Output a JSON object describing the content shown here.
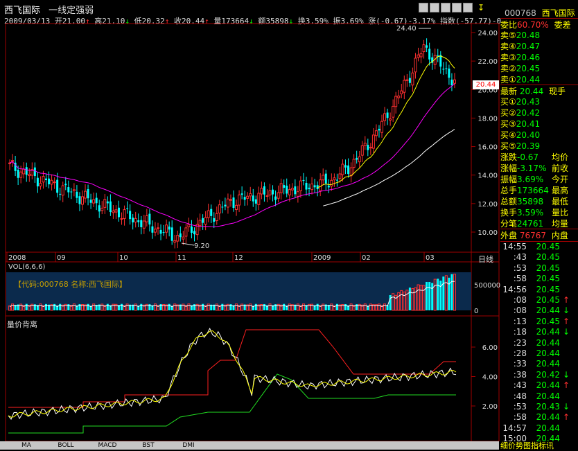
{
  "header": {
    "stock_name": "西飞国际",
    "subtitle": "一线定强弱",
    "date": "2009/03/13",
    "open_label": "开",
    "open_value": "21.00",
    "high_label": "高",
    "high_value": "21.10",
    "low_label": "低",
    "low_value": "20.32",
    "close_label": "收",
    "close_value": "20.44",
    "volume_label": "量",
    "volume_value": "173664",
    "amount_label": "额",
    "amount_value": "35898",
    "turnover_label": "换",
    "turnover_value": "3.59%",
    "amplitude_label": "振",
    "amplitude_value": "3.69%",
    "change_label": "涨",
    "change_value": "(-0.67)-3.17%",
    "index_label": "指数",
    "index_value": "(-57.77)-0"
  },
  "price_chart": {
    "yticks": [
      "24.00",
      "22.00",
      "20.00",
      "18.00",
      "16.00",
      "14.00",
      "12.00",
      "10.00"
    ],
    "current_price_tag": "20.44",
    "max_label": "24.40",
    "min_label": "9.20",
    "xaxis_labels": [
      "2008",
      "09",
      "10",
      "11",
      "12",
      "2009",
      "02",
      "03"
    ],
    "period_label": "日线",
    "colors": {
      "up": "#ff3030",
      "down": "#00ffff",
      "ma_short": "#ffffff",
      "ma_mid": "#ffff00",
      "ma_long": "#ff00ff"
    }
  },
  "volume_chart": {
    "title": "VOL(6,6,6)",
    "info_text": "【代码:000768  名称:西飞国际】",
    "ytick": "500000",
    "zero": "0"
  },
  "indicator_chart": {
    "title": "量价背离",
    "yticks": [
      "6.00",
      "4.00",
      "2.00"
    ]
  },
  "bottom_tabs": [
    "MA",
    "BOLL",
    "MACD",
    "BST",
    "DMI"
  ],
  "side_panel": {
    "code": "000768",
    "name": "西飞国际",
    "ratio_label": "委比",
    "ratio_value": "60.70%",
    "diff_label": "委差",
    "sell": [
      {
        "label": "卖⑤",
        "price": "20.48"
      },
      {
        "label": "卖④",
        "price": "20.47"
      },
      {
        "label": "卖③",
        "price": "20.46"
      },
      {
        "label": "卖②",
        "price": "20.45"
      },
      {
        "label": "卖①",
        "price": "20.44"
      }
    ],
    "latest_label": "最新",
    "latest_value": "20.44",
    "current_hand_label": "现手",
    "buy": [
      {
        "label": "买①",
        "price": "20.43"
      },
      {
        "label": "买②",
        "price": "20.42"
      },
      {
        "label": "买③",
        "price": "20.41"
      },
      {
        "label": "买④",
        "price": "20.40"
      },
      {
        "label": "买⑤",
        "price": "20.39"
      }
    ],
    "stats": [
      {
        "label": "涨跌",
        "value": "-0.67",
        "right": "均价"
      },
      {
        "label": "涨幅",
        "value": "-3.17%",
        "right": "前收"
      },
      {
        "label": "振幅",
        "value": "3.69%",
        "right": "今开"
      },
      {
        "label": "总手",
        "value": "173664",
        "right": "最高"
      },
      {
        "label": "总额",
        "value": "35898",
        "right": "最低"
      },
      {
        "label": "换手",
        "value": "3.59%",
        "right": "量比"
      },
      {
        "label": "分笔",
        "value": "24761",
        "right": "均量"
      }
    ],
    "outer_label": "外盘",
    "outer_value": "76767",
    "inner_label": "内盘",
    "ticks": [
      {
        "time": "14:55",
        "price": "20.45",
        "arrow": ""
      },
      {
        "time": ":43",
        "price": "20.45",
        "arrow": ""
      },
      {
        "time": ":53",
        "price": "20.45",
        "arrow": ""
      },
      {
        "time": ":58",
        "price": "20.45",
        "arrow": ""
      },
      {
        "time": "14:56",
        "price": "20.45",
        "arrow": ""
      },
      {
        "time": ":08",
        "price": "20.45",
        "arrow": "↑"
      },
      {
        "time": ":08",
        "price": "20.44",
        "arrow": "↓"
      },
      {
        "time": ":13",
        "price": "20.45",
        "arrow": "↑"
      },
      {
        "time": ":18",
        "price": "20.44",
        "arrow": "↓"
      },
      {
        "time": ":23",
        "price": "20.44",
        "arrow": ""
      },
      {
        "time": ":28",
        "price": "20.44",
        "arrow": ""
      },
      {
        "time": ":33",
        "price": "20.44",
        "arrow": ""
      },
      {
        "time": ":38",
        "price": "20.42",
        "arrow": "↓"
      },
      {
        "time": ":43",
        "price": "20.44",
        "arrow": "↑"
      },
      {
        "time": ":48",
        "price": "20.44",
        "arrow": ""
      },
      {
        "time": ":53",
        "price": "20.43",
        "arrow": "↓"
      },
      {
        "time": ":58",
        "price": "20.44",
        "arrow": "↑"
      },
      {
        "time": "14:57",
        "price": "20.44",
        "arrow": ""
      },
      {
        "time": "15:00",
        "price": "20.44",
        "arrow": ""
      }
    ],
    "footer": "细价势图指标讯"
  }
}
